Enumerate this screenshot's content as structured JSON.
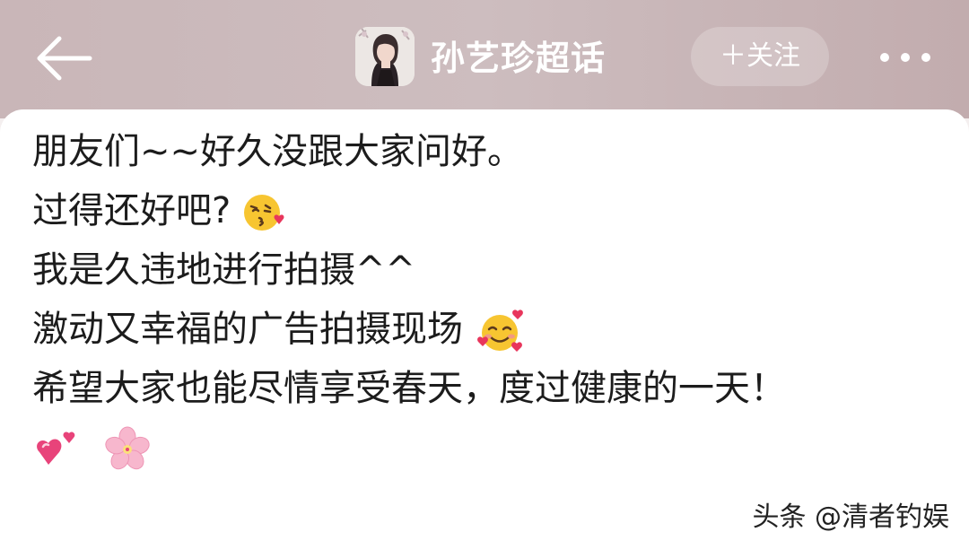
{
  "header": {
    "title": "孙艺珍超话",
    "follow_label": "＋关注",
    "back_icon": "arrow-left-icon",
    "more_icon": "more-dots-icon"
  },
  "post": {
    "lines": [
      "朋友们~~好久没跟大家问好。",
      "过得还好吧?",
      "我是久违地进行拍摄^^",
      "激动又幸福的广告拍摄现场",
      "希望大家也能尽情享受春天，度过健康的一天！"
    ],
    "emojis": [
      "face-blowing-kiss-emoji",
      "smiling-face-with-hearts-emoji",
      "two-hearts-emoji",
      "cherry-blossom-emoji"
    ]
  },
  "watermark": "头条 @清者钓娱",
  "colors": {
    "header_bg": "#c9b6b8",
    "text": "#1c1c1c",
    "emoji_yellow": "#f7c531",
    "heart_pink": "#e8437a"
  }
}
